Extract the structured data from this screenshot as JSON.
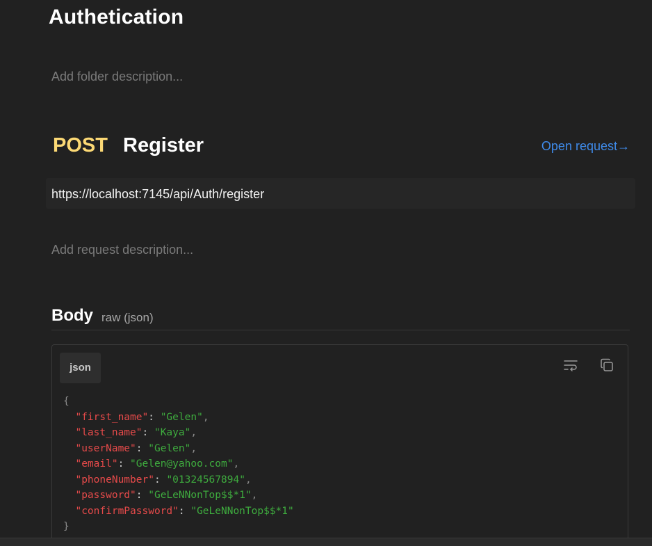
{
  "folder": {
    "title": "Authetication",
    "description_placeholder": "Add folder description..."
  },
  "request": {
    "method": "POST",
    "name": "Register",
    "open_link_label": "Open request→",
    "url": "https://localhost:7145/api/Auth/register",
    "description_placeholder": "Add request description..."
  },
  "body": {
    "label": "Body",
    "mode": "raw (json)",
    "language": "json",
    "open_brace": "{",
    "close_brace": "}",
    "fields": [
      {
        "key": "\"first_name\"",
        "value": "\"Gelen\"",
        "comma": ","
      },
      {
        "key": "\"last_name\"",
        "value": "\"Kaya\"",
        "comma": ","
      },
      {
        "key": "\"userName\"",
        "value": "\"Gelen\"",
        "comma": ","
      },
      {
        "key": "\"email\"",
        "value": "\"Gelen@yahoo.com\"",
        "comma": ","
      },
      {
        "key": "\"phoneNumber\"",
        "value": "\"01324567894\"",
        "comma": ","
      },
      {
        "key": "\"password\"",
        "value": "\"GeLeNNonTop$$*1\"",
        "comma": ","
      },
      {
        "key": "\"confirmPassword\"",
        "value": "\"GeLeNNonTop$$*1\"",
        "comma": ""
      }
    ]
  },
  "icons": {
    "wrap": "wrap-text-icon",
    "copy": "copy-icon"
  },
  "colors": {
    "background": "#212121",
    "method_post": "#fcd975",
    "link": "#3f8bea",
    "json_key": "#e64a4a",
    "json_string": "#3eab3e"
  }
}
